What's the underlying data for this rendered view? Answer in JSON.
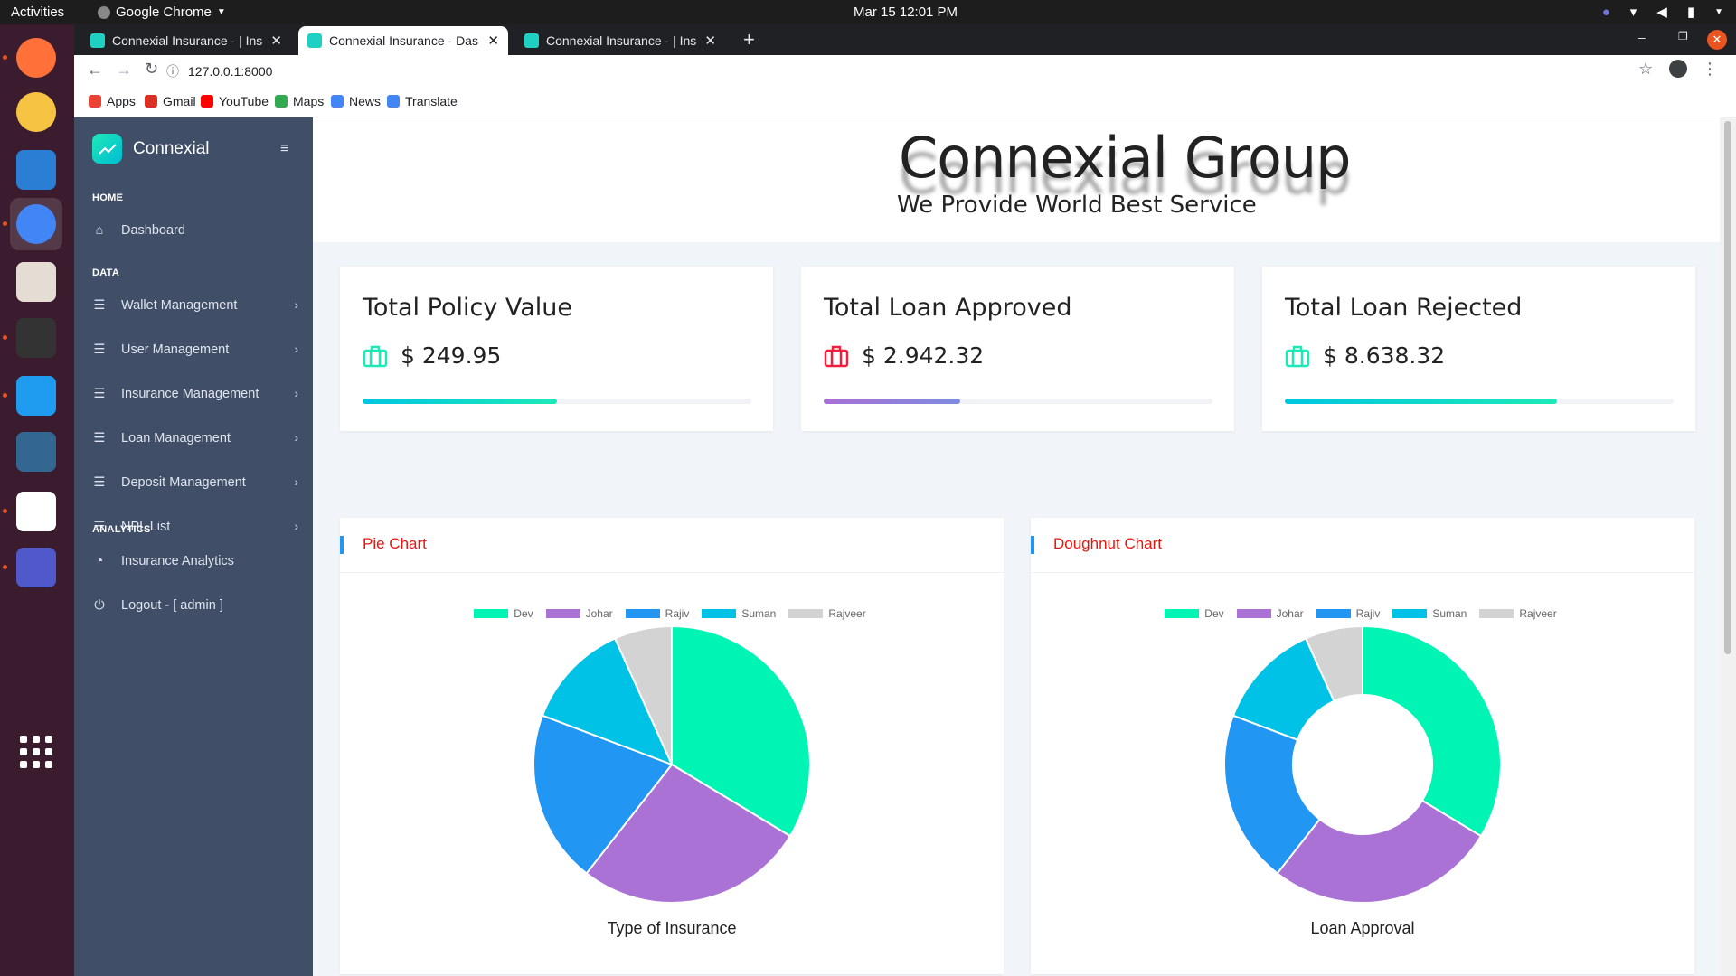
{
  "os": {
    "activities": "Activities",
    "app_name": "Google Chrome",
    "clock": "Mar 15  12:01 PM"
  },
  "dock": [
    {
      "name": "firefox-icon",
      "color": "#ff7139"
    },
    {
      "name": "rhythmbox-icon",
      "color": "#f6c342"
    },
    {
      "name": "writer-icon",
      "color": "#2a7fd5"
    },
    {
      "name": "chrome-icon",
      "color": "#4285f4"
    },
    {
      "name": "files-icon",
      "color": "#e5dcd3"
    },
    {
      "name": "terminal-icon",
      "color": "#333"
    },
    {
      "name": "vscode-icon",
      "color": "#1f9cf0"
    },
    {
      "name": "postgres-icon",
      "color": "#336791"
    },
    {
      "name": "text-editor-icon",
      "color": "#fff"
    },
    {
      "name": "teams-icon",
      "color": "#5059c9"
    },
    {
      "name": "app-grid-icon",
      "color": "#fff"
    }
  ],
  "browser": {
    "tabs": [
      {
        "title": "Connexial Insurance - | Ins"
      },
      {
        "title": "Connexial Insurance - Das"
      },
      {
        "title": "Connexial Insurance - | Ins"
      }
    ],
    "url": "127.0.0.1:8000",
    "bookmarks": [
      {
        "label": "Apps",
        "color": "#ea4335"
      },
      {
        "label": "Gmail",
        "color": "#d93025"
      },
      {
        "label": "YouTube",
        "color": "#ff0000"
      },
      {
        "label": "Maps",
        "color": "#34a853"
      },
      {
        "label": "News",
        "color": "#4285f4"
      },
      {
        "label": "Translate",
        "color": "#4285f4"
      }
    ]
  },
  "sidebar": {
    "brand": "Connexial",
    "sections": {
      "home": "HOME",
      "data": "DATA",
      "analytics": "ANALYTICS"
    },
    "dashboard": "Dashboard",
    "data_items": [
      "Wallet Management",
      "User Management",
      "Insurance Management",
      "Loan Management",
      "Deposit Management",
      "NPL List"
    ],
    "analytics": "Insurance Analytics",
    "logout": "Logout - [ admin ]"
  },
  "banner": {
    "title": "Connexial Group",
    "subtitle": "We Provide World Best Service"
  },
  "stats": [
    {
      "label": "Total Policy Value",
      "value": "$ 249.95",
      "progress": 0.5,
      "icon_color": "#1de9b6",
      "bar": "linear-gradient(90deg,#00c6e0,#1de9b6)"
    },
    {
      "label": "Total Loan Approved",
      "value": "$ 2.942.32",
      "progress": 0.35,
      "icon_color": "#f0203c",
      "bar": "linear-gradient(90deg,#a86fd6,#7d8ce0)"
    },
    {
      "label": "Total Loan Rejected",
      "value": "$ 8.638.32",
      "progress": 0.7,
      "icon_color": "#1de9b6",
      "bar": "linear-gradient(90deg,#00c6e0,#1de9b6)"
    }
  ],
  "chart_data": [
    {
      "type": "pie",
      "title": "Pie Chart",
      "caption": "Type of Insurance",
      "categories": [
        "Dev",
        "Johar",
        "Rajiv",
        "Suman",
        "Rajveer"
      ],
      "values": [
        35,
        28,
        21,
        13,
        7
      ],
      "colors": [
        "#00f5b4",
        "#ab72d6",
        "#2196f3",
        "#00c2e6",
        "#d3d3d3"
      ]
    },
    {
      "type": "doughnut",
      "title": "Doughnut Chart",
      "caption": "Loan Approval",
      "categories": [
        "Dev",
        "Johar",
        "Rajiv",
        "Suman",
        "Rajveer"
      ],
      "values": [
        35,
        28,
        21,
        13,
        7
      ],
      "colors": [
        "#00f5b4",
        "#ab72d6",
        "#2196f3",
        "#00c2e6",
        "#d3d3d3"
      ]
    }
  ]
}
